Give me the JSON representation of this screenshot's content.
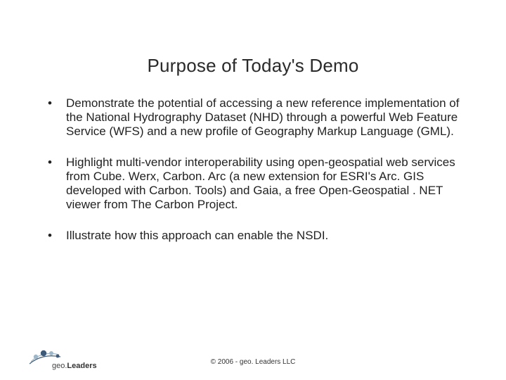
{
  "title": "Purpose of Today's Demo",
  "bullets": [
    "Demonstrate the potential of accessing a new reference implementation of the National Hydrography Dataset (NHD) through a powerful Web Feature Service (WFS) and a new profile of Geography Markup Language (GML).",
    "Highlight multi-vendor interoperability using open-geospatial web services from Cube. Werx, Carbon. Arc (a new extension for ESRI's Arc. GIS developed with Carbon. Tools) and Gaia, a free Open-Geospatial . NET viewer from The Carbon Project.",
    "Illustrate how this approach can enable the NSDI."
  ],
  "footer": {
    "copyright": "© 2006 - geo. Leaders LLC",
    "logo_prefix": "geo.",
    "logo_bold": "Leaders"
  },
  "colors": {
    "dot_dark": "#3d5a78",
    "dot_light": "#9fb8c9"
  }
}
